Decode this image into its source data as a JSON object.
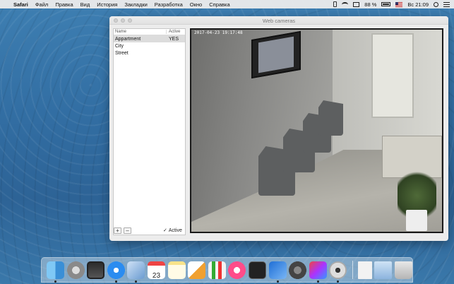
{
  "menubar": {
    "app_name": "Safari",
    "items": [
      "Файл",
      "Правка",
      "Вид",
      "История",
      "Закладки",
      "Разработка",
      "Окно",
      "Справка"
    ],
    "battery_percent": "88 %",
    "clock": "Вс 21:09"
  },
  "window": {
    "title": "Web cameras",
    "table": {
      "columns": [
        "Name",
        "Active"
      ],
      "rows": [
        {
          "name": "Appartment",
          "active": "YES",
          "selected": true
        },
        {
          "name": "City",
          "active": "",
          "selected": false
        },
        {
          "name": "Street",
          "active": "",
          "selected": false
        }
      ]
    },
    "add_label": "+",
    "remove_label": "–",
    "active_checkbox": {
      "checkmark": "✓",
      "label": "Active",
      "checked": true
    }
  },
  "camera": {
    "timestamp": "2017-04-23 19:17:48"
  },
  "dock": {
    "calendar_date": "23",
    "items": [
      "finder-icon",
      "launchpad-icon",
      "mission-control-icon",
      "safari-icon",
      "preview-icon",
      "calendar-icon",
      "notes-icon",
      "pages-icon",
      "numbers-icon",
      "itunes-icon",
      "terminal-icon",
      "xcode-icon",
      "system-preferences-icon",
      "intellij-icon",
      "webcam-app-icon",
      "document-icon",
      "mail-folder-icon",
      "trash-icon"
    ]
  }
}
